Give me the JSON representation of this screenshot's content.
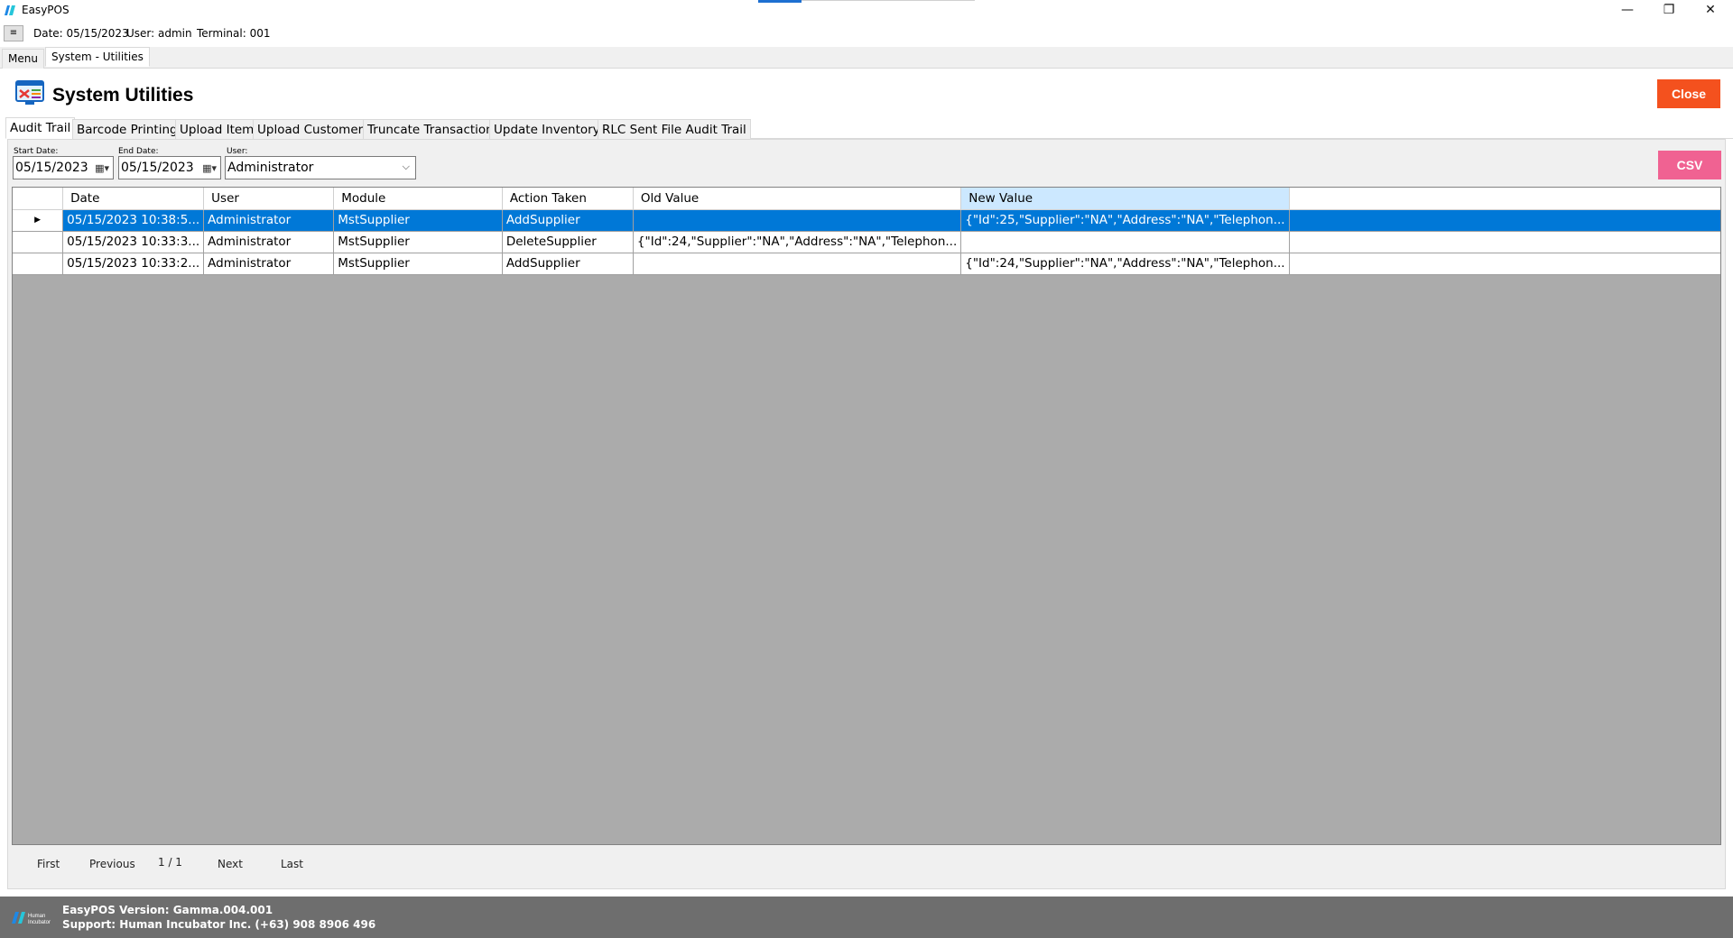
{
  "window": {
    "app_title": "EasyPOS",
    "minimize": "—",
    "restore": "❐",
    "close": "✕"
  },
  "info": {
    "menu_glyph": "≡",
    "date": "Date: 05/15/2023",
    "user": "User: admin",
    "terminal": "Terminal: 001"
  },
  "doc_tabs": {
    "menu": "Menu",
    "active": "System - Utilities"
  },
  "header": {
    "title": "System Utilities",
    "close_label": "Close"
  },
  "tabs": [
    "Audit Trail",
    "Barcode Printing",
    "Upload Item",
    "Upload Customer",
    "Truncate Transactions",
    "Update Inventory",
    "RLC Sent File Audit Trail"
  ],
  "filters": {
    "start_label": "Start Date:",
    "start_value": "05/15/2023",
    "end_label": "End Date:",
    "end_value": "05/15/2023",
    "user_label": "User:",
    "user_value": "Administrator",
    "csv_label": "CSV"
  },
  "grid": {
    "columns": [
      "Date",
      "User",
      "Module",
      "Action Taken",
      "Old Value",
      "New Value"
    ],
    "selected_column": "New Value",
    "rows": [
      {
        "date": "05/15/2023 10:38:5...",
        "user": "Administrator",
        "module": "MstSupplier",
        "action": "AddSupplier",
        "old": "",
        "new": "{\"Id\":25,\"Supplier\":\"NA\",\"Address\":\"NA\",\"Telephon..."
      },
      {
        "date": "05/15/2023 10:33:3...",
        "user": "Administrator",
        "module": "MstSupplier",
        "action": "DeleteSupplier",
        "old": "{\"Id\":24,\"Supplier\":\"NA\",\"Address\":\"NA\",\"Telephon...",
        "new": ""
      },
      {
        "date": "05/15/2023 10:33:2...",
        "user": "Administrator",
        "module": "MstSupplier",
        "action": "AddSupplier",
        "old": "",
        "new": "{\"Id\":24,\"Supplier\":\"NA\",\"Address\":\"NA\",\"Telephon..."
      }
    ],
    "selected_row_marker": "▶"
  },
  "pager": {
    "first": "First",
    "previous": "Previous",
    "page": "1 / 1",
    "next": "Next",
    "last": "Last"
  },
  "footer": {
    "logo_text": "Human Incubator",
    "version": "EasyPOS Version: Gamma.004.001",
    "support": "Support: Human Incubator Inc. (+63) 908 8906 496"
  },
  "colors": {
    "close_button": "#f4511e",
    "csv_button": "#f06292",
    "selection": "#0078d7",
    "footer": "#6e6e6e"
  }
}
